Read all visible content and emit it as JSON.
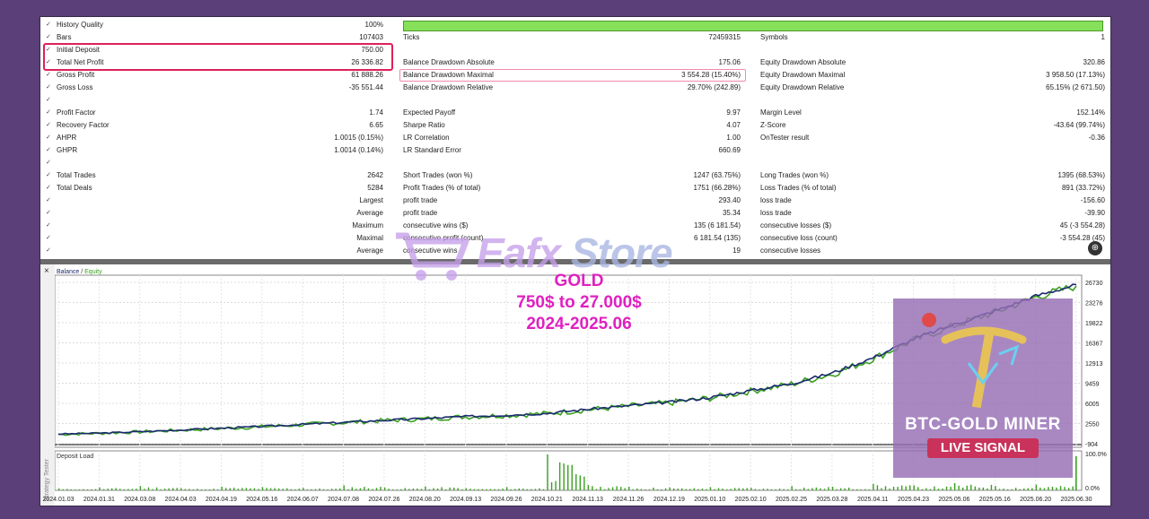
{
  "report": {
    "rows": [
      {
        "l1": "History Quality",
        "v1": "100%",
        "l2": "",
        "v2": "",
        "l3": "",
        "v3": "",
        "bar": true
      },
      {
        "l1": "Bars",
        "v1": "107403",
        "l2": "Ticks",
        "v2": "72459315",
        "l3": "Symbols",
        "v3": "1"
      },
      {
        "l1": "Initial Deposit",
        "v1": "750.00",
        "l2": "",
        "v2": "",
        "l3": "",
        "v3": ""
      },
      {
        "l1": "Total Net Profit",
        "v1": "26 336.82",
        "l2": "Balance Drawdown Absolute",
        "v2": "175.06",
        "l3": "Equity Drawdown Absolute",
        "v3": "320.86"
      },
      {
        "l1": "Gross Profit",
        "v1": "61 888.26",
        "l2": "Balance Drawdown Maximal",
        "v2": "3 554.28 (15.40%)",
        "l3": "Equity Drawdown Maximal",
        "v3": "3 958.50 (17.13%)"
      },
      {
        "l1": "Gross Loss",
        "v1": "-35 551.44",
        "l2": "Balance Drawdown Relative",
        "v2": "29.70% (242.89)",
        "l3": "Equity Drawdown Relative",
        "v3": "65.15% (2 671.50)"
      },
      {
        "l1": "",
        "v1": "",
        "l2": "",
        "v2": "",
        "l3": "",
        "v3": ""
      },
      {
        "l1": "Profit Factor",
        "v1": "1.74",
        "l2": "Expected Payoff",
        "v2": "9.97",
        "l3": "Margin Level",
        "v3": "152.14%"
      },
      {
        "l1": "Recovery Factor",
        "v1": "6.65",
        "l2": "Sharpe Ratio",
        "v2": "4.07",
        "l3": "Z-Score",
        "v3": "-43.64 (99.74%)"
      },
      {
        "l1": "AHPR",
        "v1": "1.0015 (0.15%)",
        "l2": "LR Correlation",
        "v2": "1.00",
        "l3": "OnTester result",
        "v3": "-0.36"
      },
      {
        "l1": "GHPR",
        "v1": "1.0014 (0.14%)",
        "l2": "LR Standard Error",
        "v2": "660.69",
        "l3": "",
        "v3": ""
      },
      {
        "l1": "",
        "v1": "",
        "l2": "",
        "v2": "",
        "l3": "",
        "v3": ""
      },
      {
        "l1": "Total Trades",
        "v1": "2642",
        "l2": "Short Trades (won %)",
        "v2": "1247 (63.75%)",
        "l3": "Long Trades (won %)",
        "v3": "1395 (68.53%)"
      },
      {
        "l1": "Total Deals",
        "v1": "5284",
        "l2": "Profit Trades (% of total)",
        "v2": "1751 (66.28%)",
        "l3": "Loss Trades (% of total)",
        "v3": "891 (33.72%)"
      },
      {
        "l1": "",
        "v1": "Largest",
        "l2": "profit trade",
        "v2": "293.40",
        "l3": "loss trade",
        "v3": "-156.60"
      },
      {
        "l1": "",
        "v1": "Average",
        "l2": "profit trade",
        "v2": "35.34",
        "l3": "loss trade",
        "v3": "-39.90"
      },
      {
        "l1": "",
        "v1": "Maximum",
        "l2": "consecutive wins ($)",
        "v2": "135 (6 181.54)",
        "l3": "consecutive losses ($)",
        "v3": "45 (-3 554.28)"
      },
      {
        "l1": "",
        "v1": "Maximal",
        "l2": "consecutive profit (count)",
        "v2": "6 181.54 (135)",
        "l3": "consecutive loss (count)",
        "v3": "-3 554.28 (45)"
      },
      {
        "l1": "",
        "v1": "Average",
        "l2": "consecutive wins",
        "v2": "19",
        "l3": "consecutive losses",
        "v3": ""
      }
    ]
  },
  "chart": {
    "legend_balance": "Balance",
    "legend_sep": " / ",
    "legend_equity": "Equity",
    "deposit_label": "Deposit Load",
    "tester_label": "Strategy Tester",
    "close_glyph": "×",
    "title_line1": "GOLD",
    "title_line2": "750$ to 27.000$",
    "title_line3": "2024-2025.06",
    "balance_color": "#1a2a6e",
    "equity_color": "#3aa020",
    "y_ticks": [
      "26730",
      "23276",
      "19822",
      "16367",
      "12913",
      "9459",
      "6005",
      "2550",
      "-904"
    ],
    "y_vals": [
      26730,
      23276,
      19822,
      16367,
      12913,
      9459,
      6005,
      2550,
      -904
    ],
    "load_ticks": [
      "100.0%",
      "0.0%"
    ],
    "x_ticks": [
      "2024.01.03",
      "2024.01.31",
      "2024.03.08",
      "2024.04.03",
      "2024.04.19",
      "2024.05.16",
      "2024.06.07",
      "2024.07.08",
      "2024.07.26",
      "2024.08.20",
      "2024.09.13",
      "2024.09.26",
      "2024.10.21",
      "2024.11.13",
      "2024.11.26",
      "2024.12.19",
      "2025.01.10",
      "2025.02.10",
      "2025.02.25",
      "2025.03.28",
      "2025.04.11",
      "2025.04.23",
      "2025.05.06",
      "2025.05.16",
      "2025.06.20",
      "2025.06.30"
    ]
  },
  "chart_data": {
    "type": "line",
    "x": [
      "2024.01.03",
      "2024.01.31",
      "2024.03.08",
      "2024.04.03",
      "2024.04.19",
      "2024.05.16",
      "2024.06.07",
      "2024.07.08",
      "2024.07.26",
      "2024.08.20",
      "2024.09.13",
      "2024.09.26",
      "2024.10.21",
      "2024.11.13",
      "2024.11.26",
      "2024.12.19",
      "2025.01.10",
      "2025.02.10",
      "2025.02.25",
      "2025.03.28",
      "2025.04.11",
      "2025.04.23",
      "2025.05.06",
      "2025.05.16",
      "2025.06.20",
      "2025.06.30"
    ],
    "series": [
      {
        "name": "Balance",
        "values": [
          750,
          900,
          1150,
          1450,
          1750,
          2050,
          2400,
          2750,
          3100,
          3400,
          3750,
          4000,
          4300,
          5000,
          5600,
          6200,
          7000,
          8200,
          9400,
          11200,
          13800,
          17000,
          19500,
          21800,
          24400,
          26330
        ]
      },
      {
        "name": "Equity",
        "values": [
          700,
          880,
          1120,
          1420,
          1700,
          2000,
          2350,
          2700,
          3050,
          3350,
          3700,
          3950,
          4250,
          4900,
          5500,
          6100,
          6900,
          8100,
          9300,
          11000,
          13600,
          16800,
          19300,
          21600,
          24200,
          26100
        ]
      }
    ],
    "ylim": [
      -904,
      26730
    ],
    "grid": true,
    "legend": "top-left",
    "deposit_load_pct": [
      5,
      8,
      12,
      6,
      10,
      9,
      7,
      14,
      8,
      11,
      6,
      9,
      100,
      15,
      10,
      8,
      9,
      7,
      12,
      10,
      18,
      14,
      20,
      12,
      16,
      95
    ]
  },
  "watermark": {
    "text_part1": "Eafx",
    "text_part2": " Store",
    "badge_line1": "BTC-GOLD MINER",
    "badge_line2": "LIVE SIGNAL"
  }
}
